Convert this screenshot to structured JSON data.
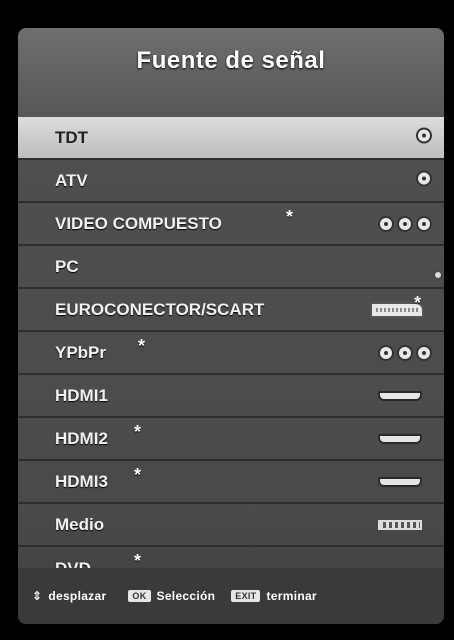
{
  "header": {
    "title": "Fuente de señal"
  },
  "sources": [
    {
      "label": "TDT",
      "icon": "rca-single-icon",
      "star": false,
      "selected": true
    },
    {
      "label": "ATV",
      "icon": "rca-single-icon",
      "star": false,
      "selected": false
    },
    {
      "label": "VIDEO COMPUESTO",
      "icon": "rca-triple-icon",
      "star": true,
      "selected": false
    },
    {
      "label": "PC",
      "icon": "vga-icon",
      "star": false,
      "selected": false
    },
    {
      "label": "EUROCONECTOR/SCART",
      "icon": "scart-icon",
      "star": true,
      "selected": false
    },
    {
      "label": "YPbPr",
      "icon": "rca-triple-icon",
      "star": true,
      "selected": false
    },
    {
      "label": "HDMI1",
      "icon": "hdmi-icon",
      "star": false,
      "selected": false
    },
    {
      "label": "HDMI2",
      "icon": "hdmi-icon",
      "star": true,
      "selected": false
    },
    {
      "label": "HDMI3",
      "icon": "hdmi-icon",
      "star": true,
      "selected": false
    },
    {
      "label": "Medio",
      "icon": "usb-icon",
      "star": false,
      "selected": false
    },
    {
      "label": "DVD",
      "icon": "none",
      "star": true,
      "selected": false
    }
  ],
  "star_symbol": "*",
  "footer": {
    "arrows_symbol": "⇕",
    "scroll_label": "desplazar",
    "ok_key": "OK",
    "select_label": "Selección",
    "exit_key": "EXIT",
    "exit_label": "terminar"
  },
  "colors": {
    "selected_bg": "#cfcfcf",
    "panel_bg": "#4a4a4a",
    "footer_bg": "#3a3a3a"
  }
}
